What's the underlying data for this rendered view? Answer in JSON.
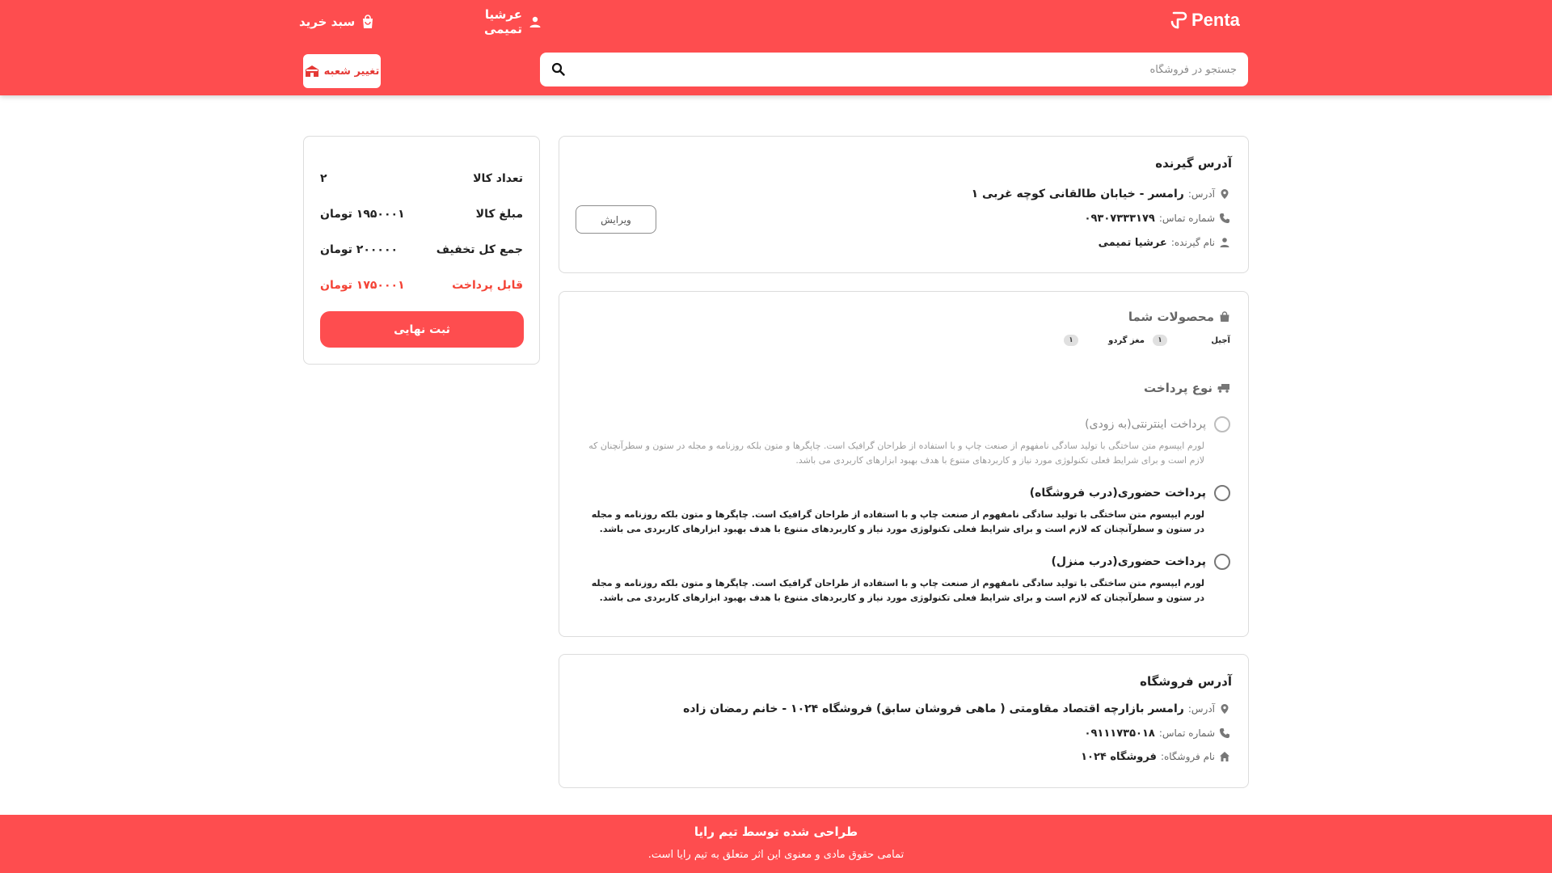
{
  "header": {
    "logo_text": "Penta",
    "user_name": "عرشیا تمیمی",
    "cart_label": "سبد خرید",
    "search_placeholder": "جستجو در فروشگاه",
    "branch_button": "تغییر شعبه",
    "accent_color": "#fe4d4f"
  },
  "receiver": {
    "title": "آدرس گیرنده",
    "address_label": "آدرس:",
    "address_value": "رامسر - خیابان طالقانی کوچه غربی ۱",
    "phone_label": "شماره تماس:",
    "phone_value": "۰۹۳۰۷۳۳۳۱۷۹",
    "name_label": "نام گیرنده:",
    "name_value": "عرشیا تمیمی",
    "edit_button": "ویرایش"
  },
  "summary": {
    "count_label": "تعداد کالا",
    "count_value": "۲",
    "amount_label": "مبلغ کالا",
    "amount_value": "۱۹۵۰۰۰۱ تومان",
    "discount_label": "جمع کل تخفیف",
    "discount_value": "۲۰۰۰۰۰ تومان",
    "payable_label": "قابل پرداخت",
    "payable_value": "۱۷۵۰۰۰۱ تومان",
    "submit_button": "ثبت نهایی"
  },
  "products": {
    "title": "محصولات شما",
    "items": [
      {
        "name": "آجیل",
        "qty": "۱"
      },
      {
        "name": "مغز گردو",
        "qty": "۱"
      }
    ]
  },
  "payment": {
    "title": "نوع پرداخت",
    "options": [
      {
        "title": "پرداخت اینترنتی(به زودی)",
        "desc": "لورم ایپسوم متن ساختگی با تولید سادگی نامفهوم از صنعت چاپ و با استفاده از طراحان گرافیک است. چاپگرها و متون بلکه روزنامه و مجله در ستون و سطرآنچنان که لازم است و برای شرایط فعلی تکنولوژی مورد نیاز و کاربردهای متنوع با هدف بهبود ابزارهای کاربردی می باشد."
      },
      {
        "title": "پرداخت حضوری(درب فروشگاه)",
        "desc": "لورم ایپسوم متن ساختگی با تولید سادگی نامفهوم از صنعت چاپ و با استفاده از طراحان گرافیک است. چاپگرها و متون بلکه روزنامه و مجله در ستون و سطرآنچنان که لازم است و برای شرایط فعلی تکنولوژی مورد نیاز و کاربردهای متنوع با هدف بهبود ابزارهای کاربردی می باشد."
      },
      {
        "title": "پرداخت حضوری(درب منزل)",
        "desc": "لورم ایپسوم متن ساختگی با تولید سادگی نامفهوم از صنعت چاپ و با استفاده از طراحان گرافیک است. چاپگرها و متون بلکه روزنامه و مجله در ستون و سطرآنچنان که لازم است و برای شرایط فعلی تکنولوژی مورد نیاز و کاربردهای متنوع با هدف بهبود ابزارهای کاربردی می باشد."
      }
    ]
  },
  "store": {
    "title": "آدرس فروشگاه",
    "address_label": "آدرس:",
    "address_value": "رامسر بازارچه اقتصاد مقاومتی ( ماهی فروشان سابق) فروشگاه ۱۰۲۴ - خانم رمضان زاده",
    "phone_label": "شماره تماس:",
    "phone_value": "۰۹۱۱۱۷۳۵۰۱۸",
    "name_label": "نام فروشگاه:",
    "name_value": "فروشگاه ۱۰۲۴"
  },
  "footer": {
    "title": "طراحی شده توسط تیم رایا",
    "copyright": "تمامی حقوق مادی و معنوی این اثر متعلق به تیم رایا است."
  },
  "icons": [
    "logo-icon",
    "user-icon",
    "cart-bag-icon",
    "search-icon",
    "store-branch-icon",
    "location-pin-icon",
    "phone-icon",
    "person-icon",
    "bag-icon",
    "truck-icon",
    "home-icon"
  ]
}
